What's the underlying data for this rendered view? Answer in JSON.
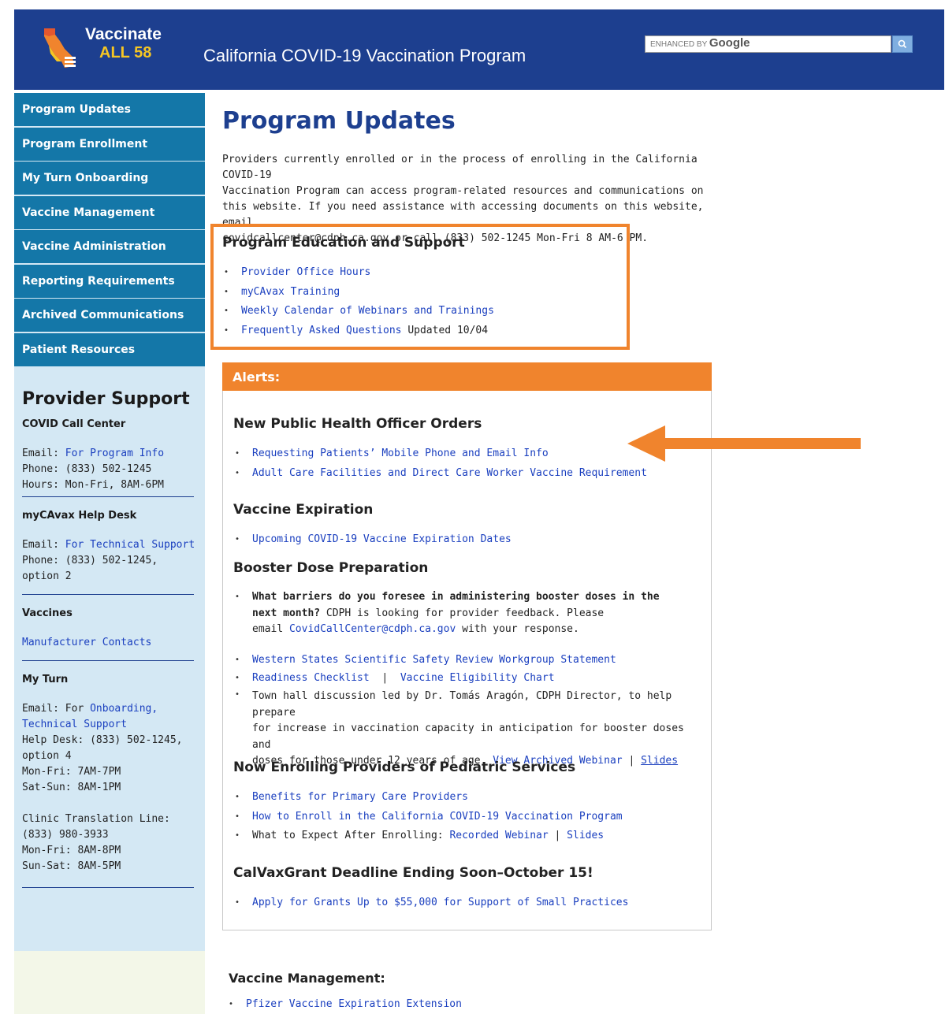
{
  "header": {
    "logo_line1": "Vaccinate",
    "logo_line2": "ALL 58",
    "title": "California COVID-19 Vaccination Program",
    "search_enhanced": "ENHANCED BY",
    "search_google": "Google",
    "colors": {
      "bar": "#1d3f8f",
      "logo_accent": "#f6c623",
      "search_button": "#7faee0"
    }
  },
  "sidebar": {
    "nav": [
      {
        "label": "Program Updates"
      },
      {
        "label": "Program Enrollment"
      },
      {
        "label": "My Turn Onboarding"
      },
      {
        "label": "Vaccine Management"
      },
      {
        "label": "Vaccine Administration"
      },
      {
        "label": "Reporting Requirements"
      },
      {
        "label": "Archived Communications"
      },
      {
        "label": "Patient Resources"
      }
    ],
    "provider_title": "Provider Support",
    "call_center": {
      "title": "COVID Call Center",
      "email_label": "Email:",
      "email_link": "For Program Info",
      "phone": "Phone: (833) 502-1245",
      "hours": "Hours: Mon-Fri, 8AM-6PM"
    },
    "help_desk": {
      "title": "myCAvax Help Desk",
      "email_label": "Email:",
      "email_link": "For Technical Support",
      "phone_1": "Phone: (833) 502-1245,",
      "phone_2": "option 2"
    },
    "vaccines": {
      "title": "Vaccines",
      "link": "Manufacturer Contacts"
    },
    "my_turn": {
      "title": "My Turn",
      "email_prefix": "Email: For",
      "link1": "Onboarding,",
      "link2": "Technical Support",
      "help_1": "Help Desk: (833) 502-1245,",
      "help_2": "option 4",
      "hours_1": "Mon-Fri: 7AM-7PM",
      "hours_2": "Sat-Sun: 8AM-1PM",
      "translation_title": "Clinic Translation Line:",
      "translation_phone": "(833) 980-3933",
      "translation_hours_1": "Mon-Fri: 8AM-8PM",
      "translation_hours_2": "Sun-Sat: 8AM-5PM"
    },
    "colors": {
      "nav": "#1477a8",
      "panel": "#d4e8f4"
    }
  },
  "main": {
    "title": "Program Updates",
    "intro_1": "Providers currently enrolled or in the process of enrolling in the California COVID-19",
    "intro_2": "Vaccination Program can access program-related resources and communications on",
    "intro_3": "this website. If you need assistance with accessing documents on this website, email",
    "intro_4": "covidcallcenter@cdph.ca.gov or call (833) 502-1245 Mon-Fri 8 AM-6 PM.",
    "education": {
      "title": "Program Education and Support",
      "items": [
        {
          "label": "Provider Office Hours"
        },
        {
          "label": "myCAvax Training"
        },
        {
          "label": "Weekly Calendar of Webinars and Trainings"
        },
        {
          "label": "Frequently Asked Questions",
          "note": " Updated 10/04"
        }
      ]
    },
    "alerts": {
      "header": "Alerts:",
      "phoo_title": "New Public Health Officer Orders",
      "phoo_items": [
        {
          "label": "Requesting Patients’ Mobile Phone and Email Info"
        },
        {
          "label": "Adult Care Facilities and Direct Care Worker Vaccine Requirement"
        }
      ],
      "expiration_title": "Vaccine Expiration",
      "expiration_items": [
        {
          "label": "Upcoming COVID-19 Vaccine Expiration Dates"
        }
      ],
      "booster_title": "Booster Dose Preparation",
      "booster_q_1": "What barriers do you foresee in administering booster doses in the",
      "booster_q_2": "next month?",
      "booster_q_tail": " CDPH is looking for provider feedback. Please",
      "booster_q_email_prefix": "email ",
      "booster_q_email": "CovidCallCenter@cdph.ca.gov",
      "booster_q_suffix": " with your response.",
      "booster_link_1": "Western States Scientific Safety Review Workgroup Statement",
      "booster_link_2": "Readiness Checklist",
      "booster_sep": "|",
      "booster_link_3": "Vaccine Eligibility Chart",
      "townhall_1": "Town hall discussion led by Dr. Tomás Aragón, CDPH Director, to help prepare",
      "townhall_2": "for increase in vaccination capacity in anticipation for booster doses and",
      "townhall_3": "doses for those under 12 years of age.",
      "townhall_link1": "View Archived Webinar",
      "townhall_link2": "Slides",
      "pediatric_title": "Now Enrolling Providers of Pediatric Services",
      "pediatric_1": "Benefits for Primary Care Providers",
      "pediatric_2": "How to Enroll in the California COVID-19 Vaccination Program",
      "pediatric_3_prefix": "What to Expect After Enrolling: ",
      "pediatric_3_link1": "Recorded Webinar",
      "pediatric_3_link2": "Slides",
      "grant_title": "CalVaxGrant Deadline Ending Soon–October 15!",
      "grant_link": "Apply for Grants Up to $55,000 for Support of Small Practices",
      "colors": {
        "header": "#f0842d"
      }
    },
    "vaccine_management": {
      "title": "Vaccine Management:",
      "items": [
        {
          "label": "Pfizer Vaccine Expiration Extension"
        }
      ]
    }
  }
}
